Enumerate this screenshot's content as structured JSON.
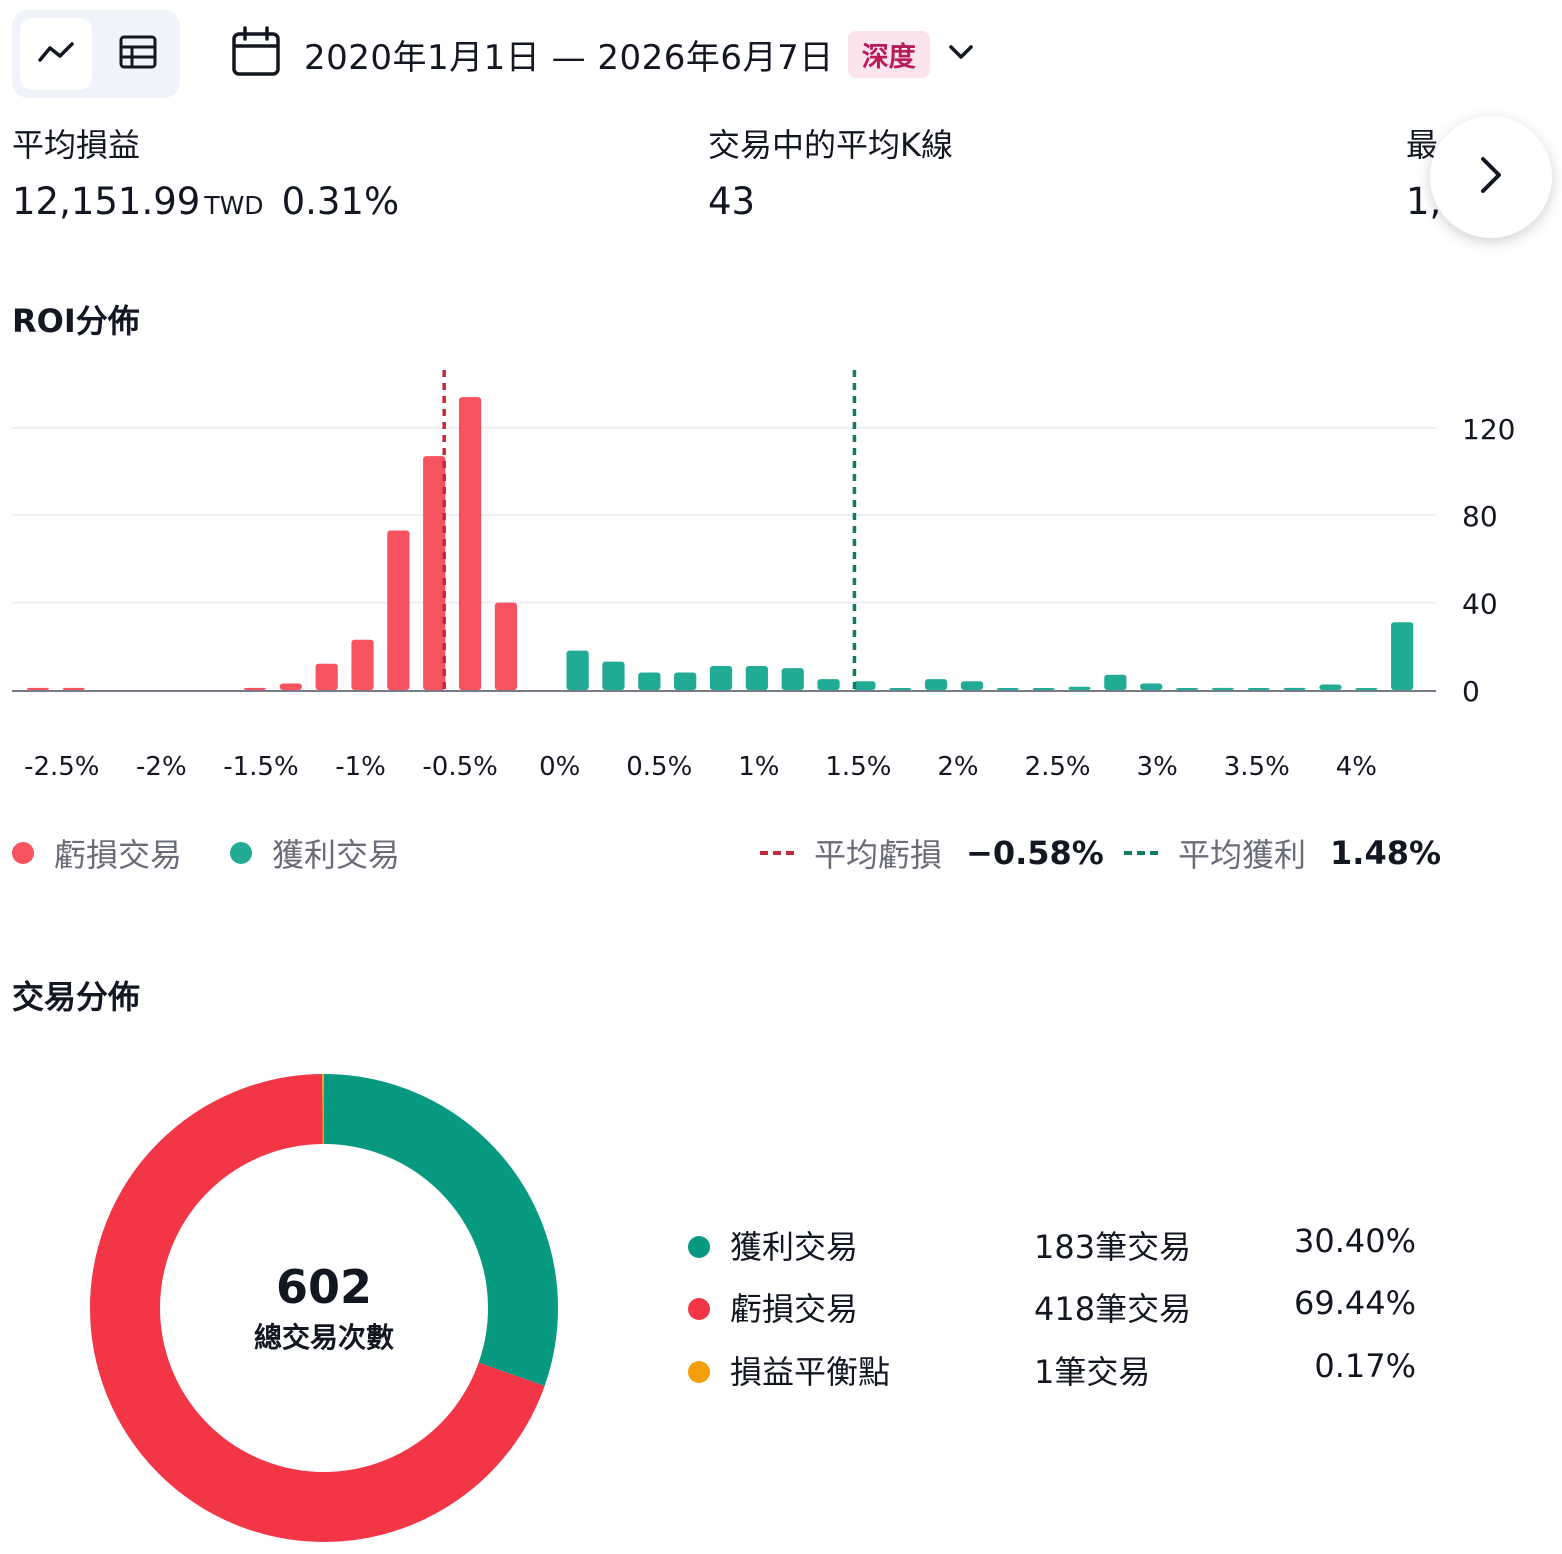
{
  "toolbar": {
    "view_buttons": [
      {
        "name": "chart-view-icon",
        "active": true
      },
      {
        "name": "table-view-icon",
        "active": false
      }
    ],
    "date_range": "2020年1月1日 — 2026年6月7日",
    "badge": "深度",
    "calendar_icon": "calendar-icon",
    "dropdown_icon": "chevron-down-icon"
  },
  "metrics": [
    {
      "label": "平均損益",
      "value": "12,151.99",
      "unit": "TWD",
      "pct": "0.31%"
    },
    {
      "label": "交易中的平均K線",
      "value": "43"
    },
    {
      "label": "最",
      "value": "1,"
    }
  ],
  "next_icon": "chevron-right-icon",
  "roi_section": {
    "title": "ROI分佈",
    "legend": {
      "loss_label": "虧損交易",
      "profit_label": "獲利交易",
      "avg_loss_label": "平均虧損",
      "avg_loss_value": "−0.58%",
      "avg_profit_label": "平均獲利",
      "avg_profit_value": "1.48%"
    }
  },
  "chart_data": {
    "type": "bar",
    "title": "ROI分佈",
    "x_tick_labels": [
      "-2.5%",
      "-2%",
      "-1.5%",
      "-1%",
      "-0.5%",
      "0%",
      "0.5%",
      "1%",
      "1.5%",
      "2%",
      "2.5%",
      "3%",
      "3.5%",
      "4%"
    ],
    "x_ticks": [
      -2.5,
      -2,
      -1.5,
      -1,
      -0.5,
      0,
      0.5,
      1,
      1.5,
      2,
      2.5,
      3,
      3.5,
      4
    ],
    "xlim": [
      -2.75,
      4.4
    ],
    "y_ticks": [
      0,
      40,
      80,
      120
    ],
    "ylim": [
      0,
      135
    ],
    "y_axis_side": "right",
    "grid": true,
    "bin_width": 0.18,
    "series": [
      {
        "name": "虧損交易",
        "color": "#f7525f",
        "x": [
          -2.71,
          -2.53,
          -1.62,
          -1.44,
          -1.26,
          -1.08,
          -0.9,
          -0.72,
          -0.54,
          -0.36,
          -0.18
        ],
        "values": [
          1,
          1,
          1,
          3,
          12,
          23,
          73,
          107,
          134,
          40,
          0
        ]
      },
      {
        "name": "獲利交易",
        "color": "#22ab94",
        "x": [
          0,
          0.18,
          0.36,
          0.54,
          0.72,
          0.9,
          1.08,
          1.26,
          1.44,
          1.62,
          1.8,
          1.98,
          2.16,
          2.34,
          2.52,
          2.7,
          2.88,
          3.06,
          3.24,
          3.42,
          3.6,
          3.78,
          3.96,
          4.14,
          4.32
        ],
        "values": [
          18,
          13,
          8,
          8,
          11,
          11,
          10,
          5,
          4,
          0.5,
          5,
          4,
          0.5,
          0.5,
          1.5,
          7,
          3,
          0.5,
          1,
          0.5,
          1,
          2.5,
          0.5,
          31,
          0
        ]
      }
    ],
    "reference_lines": [
      {
        "name": "平均虧損",
        "x": -0.58,
        "color": "#c62838"
      },
      {
        "name": "平均獲利",
        "x": 1.48,
        "color": "#0f7b62"
      }
    ]
  },
  "trade_distribution": {
    "title": "交易分佈",
    "total": "602",
    "total_label": "總交易次數",
    "items": [
      {
        "label": "獲利交易",
        "count": "183筆交易",
        "pct": "30.40%",
        "value": 183,
        "color": "#089981"
      },
      {
        "label": "虧損交易",
        "count": "418筆交易",
        "pct": "69.44%",
        "value": 418,
        "color": "#f23645"
      },
      {
        "label": "損益平衡點",
        "count": "1筆交易",
        "pct": "0.17%",
        "value": 1,
        "color": "#f59e0b"
      }
    ]
  }
}
